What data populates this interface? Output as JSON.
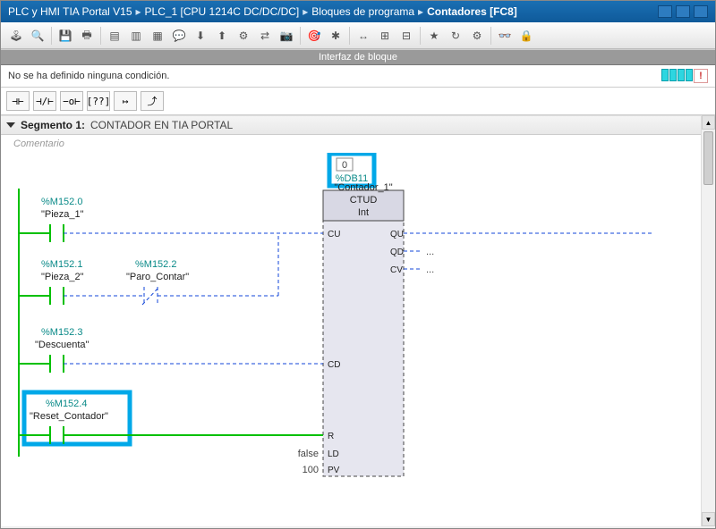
{
  "breadcrumb": {
    "a": "PLC y HMI TIA Portal V15",
    "b": "PLC_1 [CPU 1214C DC/DC/DC]",
    "c": "Bloques de programa",
    "d": "Contadores [FC8]",
    "sep": "▸"
  },
  "interface_label": "Interfaz de bloque",
  "condition_text": "No se ha definido ninguna condición.",
  "segment": {
    "prefix": "Segmento 1:",
    "title": "CONTADOR EN TIA PORTAL",
    "comment": "Comentario"
  },
  "counter": {
    "live_value": "0",
    "db": "%DB11",
    "instance_name": "\"Contador_1\"",
    "type": "CTUD",
    "subtype": "Int",
    "pins_left": [
      "CU",
      "CD",
      "R",
      "LD",
      "PV"
    ],
    "pins_right": [
      "QU",
      "QD",
      "CV"
    ],
    "ld_input": "false",
    "pv_input": "100",
    "out_placeholder": "..."
  },
  "tags": {
    "r1": {
      "addr": "%M152.0",
      "name": "\"Pieza_1\""
    },
    "r2a": {
      "addr": "%M152.1",
      "name": "\"Pieza_2\""
    },
    "r2b": {
      "addr": "%M152.2",
      "name": "\"Paro_Contar\""
    },
    "r3": {
      "addr": "%M152.3",
      "name": "\"Descuenta\""
    },
    "r4": {
      "addr": "%M152.4",
      "name": "\"Reset_Contador\""
    }
  },
  "ladtool_labels": [
    "⊣⊢",
    "⊣/⊢",
    "−o⊢",
    "[??]",
    "↦",
    "⤴"
  ]
}
